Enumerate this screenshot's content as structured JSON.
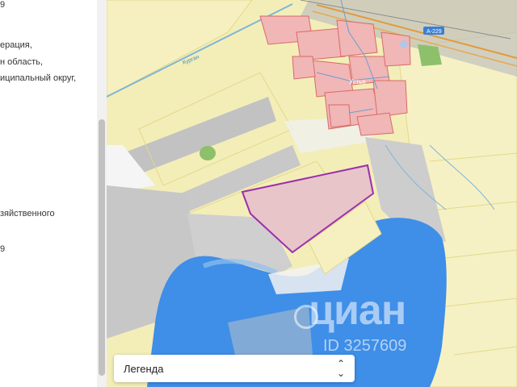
{
  "sidebar": {
    "lines": [
      "9",
      "ерация,",
      "н область,",
      "иципальный округ,",
      "зяйственного",
      "9"
    ]
  },
  "map": {
    "road_label": "Курган",
    "highway_badge": "А-229",
    "village_label": "Устье",
    "watermark": "циан",
    "watermark_id": "ID 3257609",
    "colors": {
      "farmland": "#f3eeb8",
      "water": "#3f8ee8",
      "gray_area": "#c9c9c9",
      "parcel_fill": "#e8c5c8",
      "parcel_border": "#9b2fb0",
      "buildings": "#f1b6b6",
      "building_border": "#d86a6a"
    }
  },
  "legend": {
    "label": "Легенда"
  }
}
